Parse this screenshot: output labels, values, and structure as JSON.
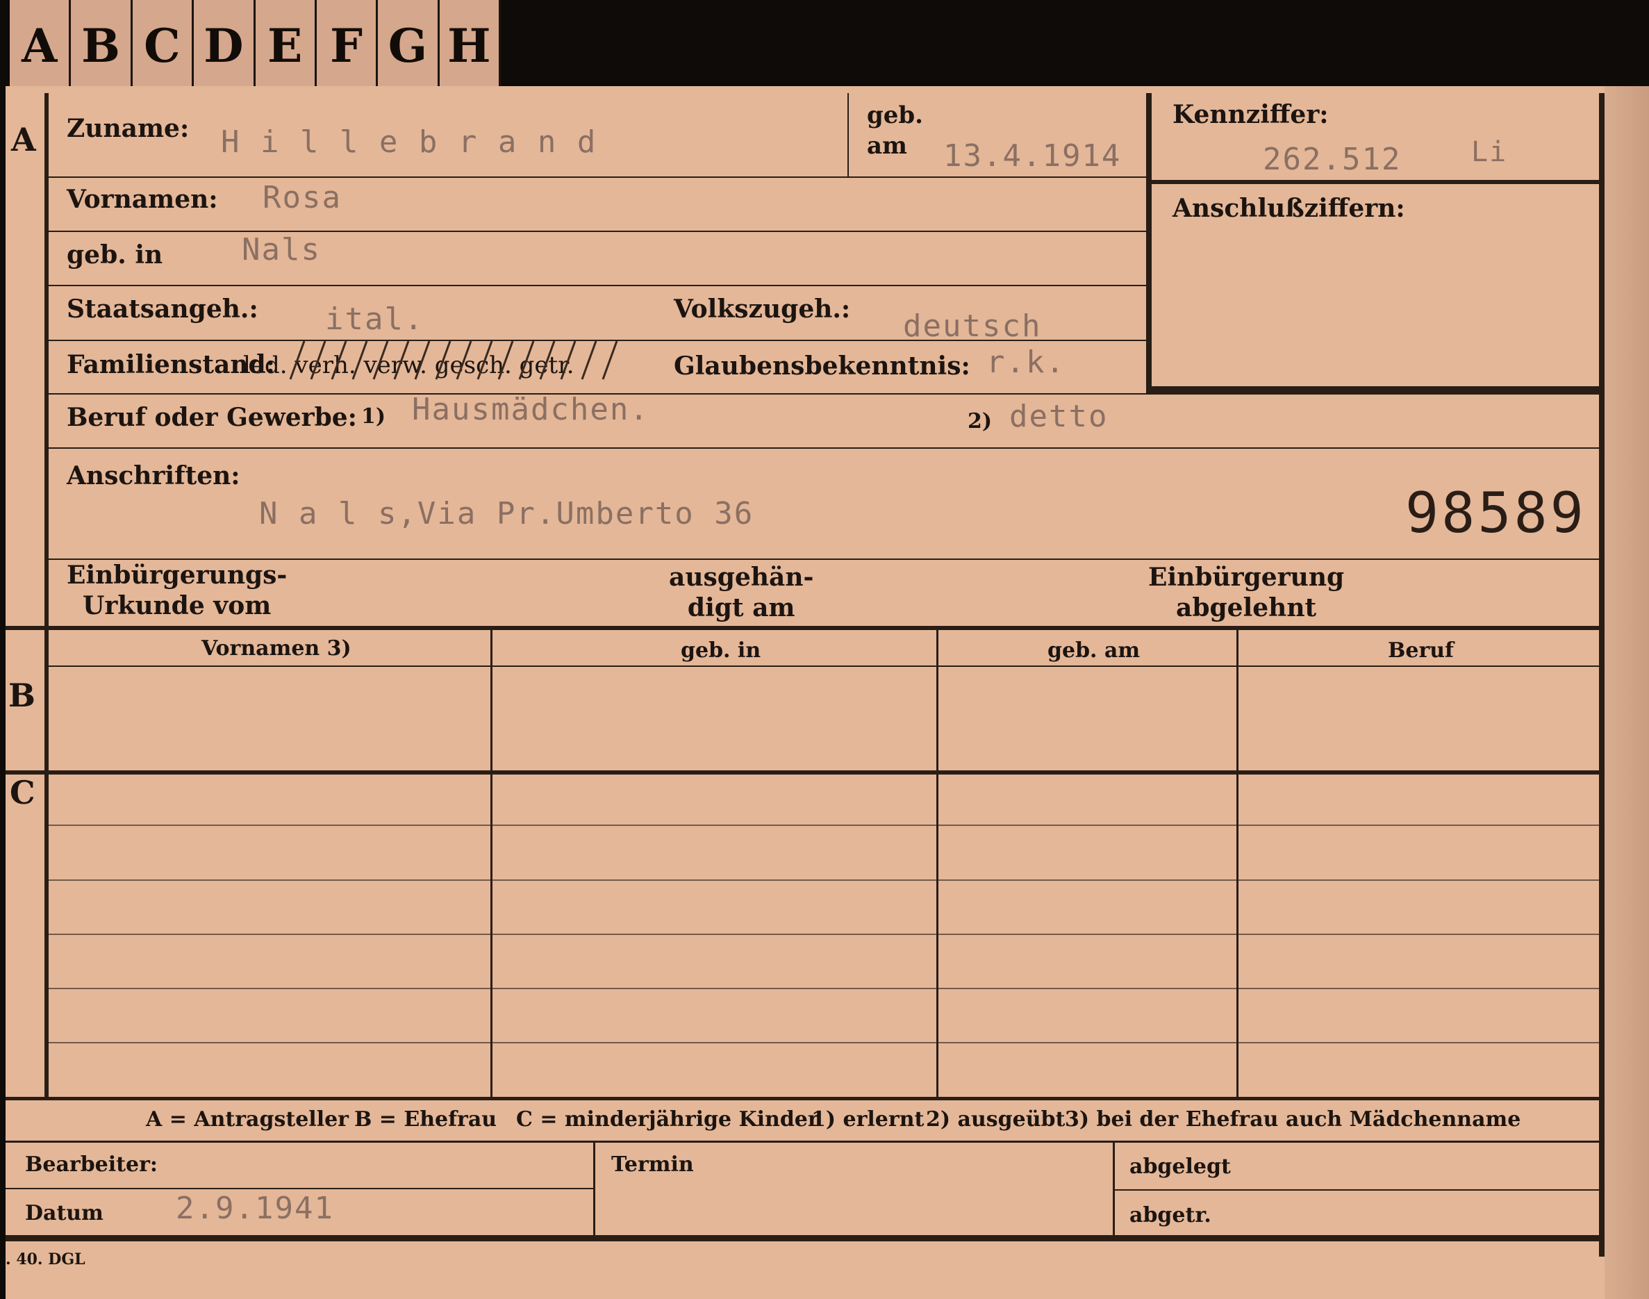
{
  "tabs": [
    "A",
    "B",
    "C",
    "D",
    "E",
    "F",
    "G",
    "H"
  ],
  "labels": {
    "zuname": "Zuname:",
    "geb_am": "geb.\nam",
    "kennziffer": "Kennziffer:",
    "anschlussziffern": "Anschlußziffern:",
    "vornamen": "Vornamen:",
    "geb_in": "geb. in",
    "staatsangeh": "Staatsangeh.:",
    "volkszugeh": "Volkszugeh.:",
    "familienstand": "Familienstand:",
    "familienstand_options": "led. verh. verw. gesch. getr.",
    "glaubensbekenntnis": "Glaubensbekenntnis:",
    "beruf": "Beruf oder Gewerbe:",
    "beruf_mark1": "1)",
    "beruf_mark2": "2)",
    "anschriften": "Anschriften:",
    "einbuergerungs_urkunde": "Einbürgerungs-\nUrkunde vom",
    "ausgehaendigt": "ausgehän-\ndigt am",
    "einbuergerung_abgelehnt": "Einbürgerung\nabgelehnt"
  },
  "values": {
    "zuname": "H i l l e b r a n d",
    "geb_am": "13.4.1914",
    "kennziffer": "262.512",
    "kennziffer_suffix": "Li",
    "vornamen": "Rosa",
    "geb_in": "Nals",
    "staatsangeh": "ital.",
    "volkszugeh": "deutsch",
    "glaubensbekenntnis": "r.k.",
    "beruf_erlernt": "Hausmädchen.",
    "beruf_ausgeuebt": "detto",
    "anschrift": "N a l s,Via Pr.Umberto 36",
    "stamp_number": "98589"
  },
  "section_letters": {
    "a": "A",
    "b": "B",
    "c": "C"
  },
  "table_headers": [
    "Vornamen 3)",
    "geb. in",
    "geb. am",
    "Beruf"
  ],
  "legend": {
    "a": "A = Antragsteller",
    "b": "B = Ehefrau",
    "c": "C = minderjährige Kinder",
    "n1": "1) erlernt",
    "n2": "2) ausgeübt",
    "n3": "3) bei der Ehefrau auch Mädchenname"
  },
  "footer": {
    "bearbeiter": "Bearbeiter:",
    "datum_label": "Datum",
    "datum_value": "2.9.1941",
    "termin": "Termin",
    "abgelegt": "abgelegt",
    "abgetr": "abgetr.",
    "print_mark": ". 40. DGL"
  },
  "colors": {
    "card": "#e3b798",
    "ink": "#2a1d16",
    "typed": "#8b6f62",
    "background": "#0e0b09"
  }
}
